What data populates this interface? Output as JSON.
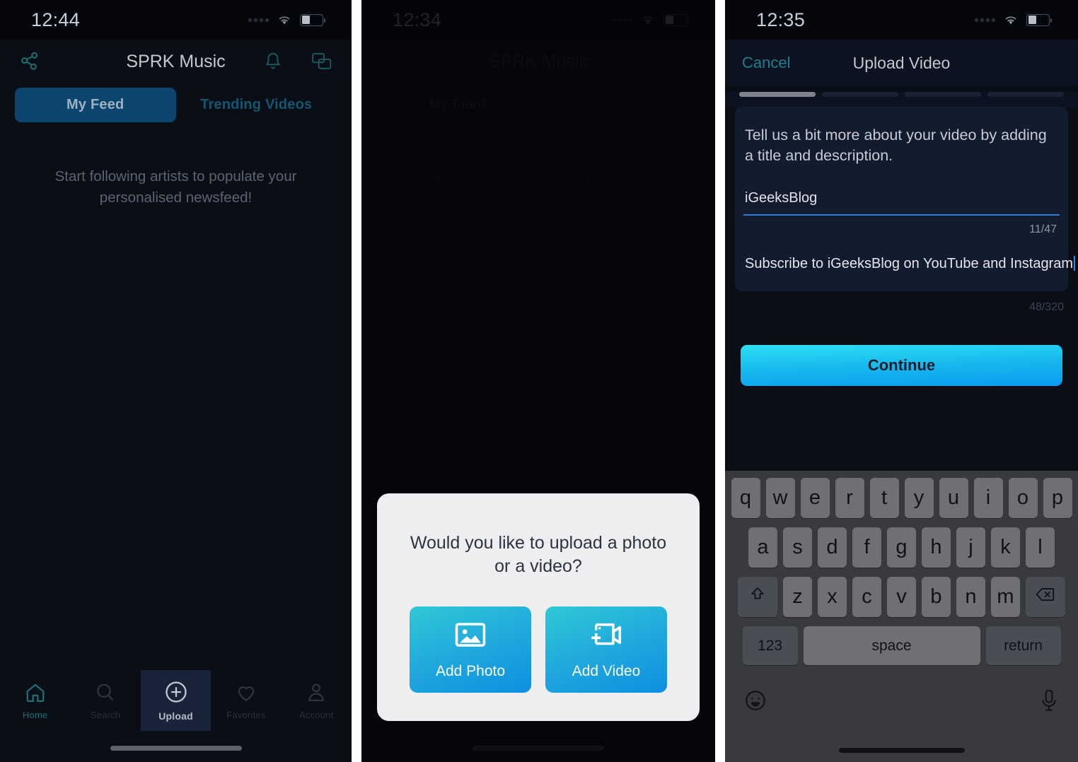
{
  "panels": {
    "feed": {
      "status": {
        "time": "12:44"
      },
      "header": {
        "title": "SPRK Music",
        "share_icon": "share-network-icon",
        "bell_icon": "bell-icon",
        "chat_icon": "chat-bubbles-icon"
      },
      "tabs": [
        {
          "label": "My Feed",
          "active": true
        },
        {
          "label": "Trending Videos",
          "active": false
        }
      ],
      "empty_message": "Start following artists to populate your personalised newsfeed!",
      "tabbar": [
        {
          "label": "Home",
          "icon": "home-icon",
          "state": "selected"
        },
        {
          "label": "Search",
          "icon": "search-icon",
          "state": "normal"
        },
        {
          "label": "Upload",
          "icon": "plus-circle-icon",
          "state": "active"
        },
        {
          "label": "Favorites",
          "icon": "heart-icon",
          "state": "normal"
        },
        {
          "label": "Account",
          "icon": "person-icon",
          "state": "normal"
        }
      ]
    },
    "upload_choice": {
      "status": {
        "time": "12:34"
      },
      "header": {
        "title": "SPRK Music"
      },
      "tabs": [
        {
          "label": "My Feed",
          "active": true
        },
        {
          "label": "Trending Videos",
          "active": false
        }
      ],
      "empty_message": "Start following artists to populate your personalised newsfeed!",
      "dialog": {
        "question": "Would you like to upload a photo or a video?",
        "buttons": [
          {
            "label": "Add Photo",
            "icon": "photo-icon"
          },
          {
            "label": "Add Video",
            "icon": "video-plus-icon"
          }
        ]
      }
    },
    "upload_video": {
      "status": {
        "time": "12:35"
      },
      "header": {
        "cancel_label": "Cancel",
        "title": "Upload Video"
      },
      "progress": {
        "total_steps": 4,
        "current_step": 1
      },
      "form": {
        "hint": "Tell us a bit more about your video by adding a title and description.",
        "title_field": {
          "value": "iGeeksBlog",
          "counter": "11/47"
        },
        "description_field": {
          "value": "Subscribe to iGeeksBlog on YouTube and Instagram",
          "counter": "48/320"
        }
      },
      "continue_label": "Continue",
      "keyboard": {
        "row1": [
          "q",
          "w",
          "e",
          "r",
          "t",
          "y",
          "u",
          "i",
          "o",
          "p"
        ],
        "row2": [
          "a",
          "s",
          "d",
          "f",
          "g",
          "h",
          "j",
          "k",
          "l"
        ],
        "row3": [
          "z",
          "x",
          "c",
          "v",
          "b",
          "n",
          "m"
        ],
        "shift_icon": "shift-arrow-icon",
        "backspace_icon": "backspace-icon",
        "numbers_label": "123",
        "space_label": "space",
        "return_label": "return",
        "emoji_icon": "emoji-smiley-icon",
        "mic_icon": "microphone-icon"
      }
    }
  },
  "colors": {
    "app_background": "#0a0e17",
    "tab_active_bg": "#0d456e",
    "teal_accent": "#1f7d92",
    "button_gradient_start": "#2ee0f3",
    "button_gradient_end": "#0b9bf0",
    "dialog_background": "#eeeef0",
    "keyboard_background": "#393a3e"
  }
}
